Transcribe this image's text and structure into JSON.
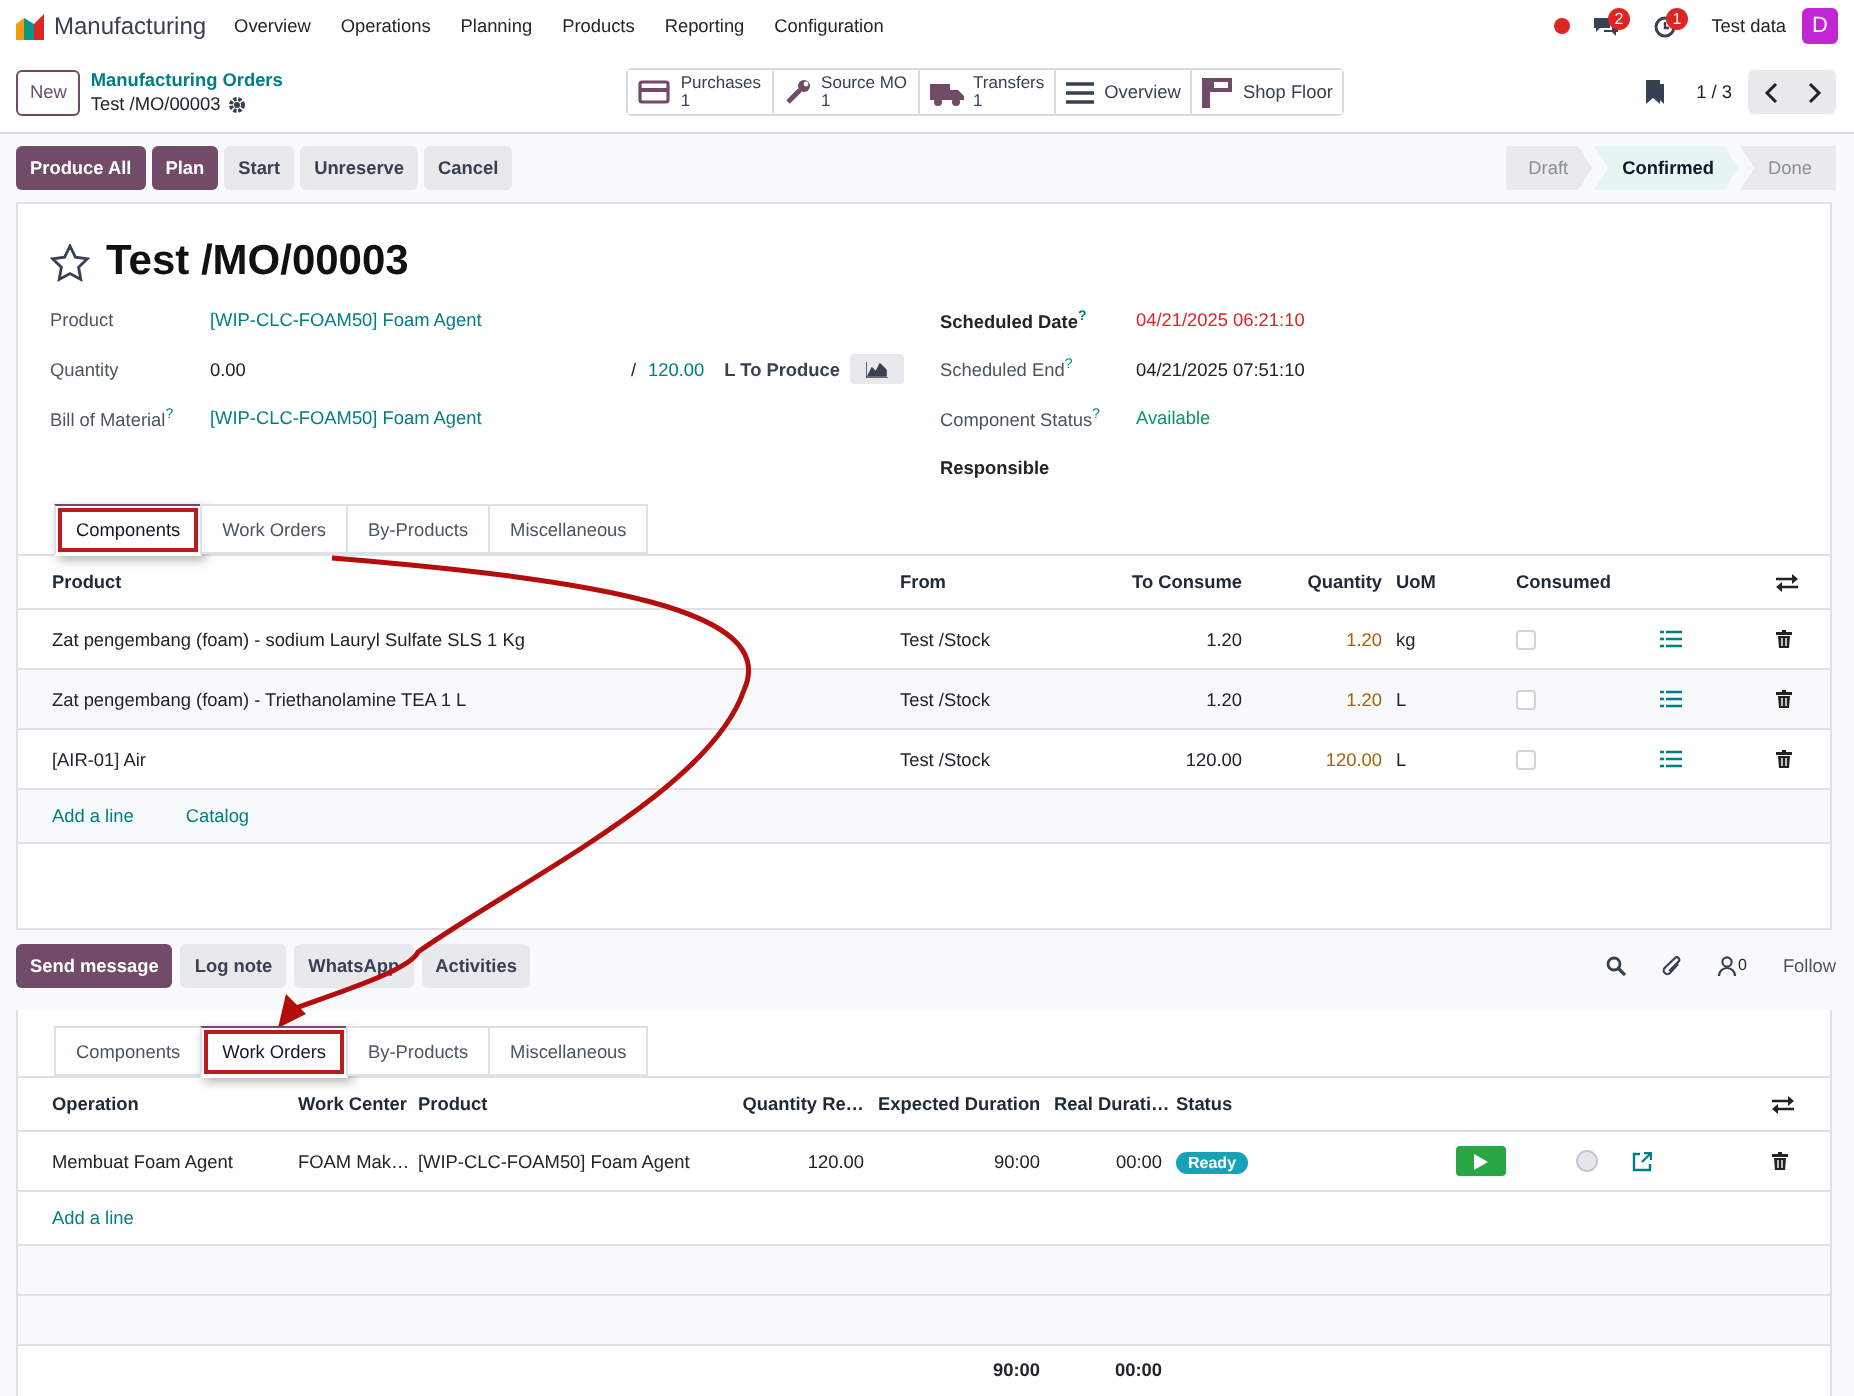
{
  "navbar": {
    "app_name": "Manufacturing",
    "menu": [
      "Overview",
      "Operations",
      "Planning",
      "Products",
      "Reporting",
      "Configuration"
    ],
    "messages_count": "2",
    "activities_count": "1",
    "user": "Test data",
    "avatar_letter": "D"
  },
  "control_panel": {
    "new_button": "New",
    "breadcrumb_parent": "Manufacturing Orders",
    "record": "Test /MO/00003",
    "smart_buttons": [
      {
        "label": "Purchases",
        "count": "1"
      },
      {
        "label": "Source MO",
        "count": "1"
      },
      {
        "label": "Transfers",
        "count": "1"
      },
      {
        "label": "Overview"
      },
      {
        "label": "Shop Floor"
      }
    ],
    "pager": "1 / 3"
  },
  "actions": [
    {
      "label": "Produce All",
      "kind": "primary"
    },
    {
      "label": "Plan",
      "kind": "primary"
    },
    {
      "label": "Start",
      "kind": "secondary"
    },
    {
      "label": "Unreserve",
      "kind": "secondary"
    },
    {
      "label": "Cancel",
      "kind": "secondary"
    }
  ],
  "status_steps": [
    {
      "label": "Draft",
      "selected": false
    },
    {
      "label": "Confirmed",
      "selected": true
    },
    {
      "label": "Done",
      "selected": false
    }
  ],
  "form": {
    "title": "Test /MO/00003",
    "starred": false,
    "product": {
      "label": "Product",
      "value": "[WIP-CLC-FOAM50] Foam Agent"
    },
    "quantity": {
      "label": "Quantity",
      "value": "0.00",
      "separator": "/",
      "target": "120.00",
      "unit_text": "L To Produce"
    },
    "bom": {
      "label": "Bill of Material$^{?}$",
      "value": "[WIP-CLC-FOAM50] Foam Agent"
    },
    "right_fields": [
      {
        "label": "Scheduled Date$^{?}$",
        "value": "04/21/2025 06:21:10",
        "kind": "late",
        "required": true
      },
      {
        "label": "Scheduled End$^{?}$",
        "value": "04/21/2025 07:51:10",
        "kind": "plain",
        "required": false
      },
      {
        "label": "Component Status$^{?}$",
        "value": "Available",
        "kind": "ok",
        "required": false
      },
      {
        "label": "Responsible",
        "required": true
      }
    ]
  },
  "tabs": [
    {
      "label": "Components",
      "selected": true,
      "highlighted": true
    },
    {
      "label": "Work Orders",
      "selected": false,
      "highlighted": false
    },
    {
      "label": "By-Products",
      "selected": false,
      "highlighted": false
    },
    {
      "label": "Miscellaneous",
      "selected": false,
      "highlighted": false
    }
  ],
  "components": {
    "columns": [
      "Product",
      "From",
      "To Consume",
      "Quantity",
      "UoM",
      "Consumed"
    ],
    "rows": [
      {
        "product": "Zat pengembang (foam) - sodium Lauryl Sulfate SLS 1 Kg",
        "from": "Test /Stock",
        "to_consume": "1.20",
        "quantity": "1.20",
        "uom": "kg",
        "consumed": false
      },
      {
        "product": "Zat pengembang (foam) - Triethanolamine TEA 1 L",
        "from": "Test /Stock",
        "to_consume": "1.20",
        "quantity": "1.20",
        "uom": "L",
        "consumed": false
      },
      {
        "product": "[AIR-01] Air",
        "from": "Test /Stock",
        "to_consume": "120.00",
        "quantity": "120.00",
        "uom": "L",
        "consumed": false
      }
    ],
    "links": [
      "Add a line",
      "Catalog"
    ]
  },
  "chatter": {
    "buttons": [
      {
        "label": "Send message",
        "kind": "primary"
      },
      {
        "label": "Log note",
        "kind": "secondary"
      },
      {
        "label": "WhatsApp",
        "kind": "secondary"
      },
      {
        "label": "Activities",
        "kind": "secondary"
      }
    ],
    "followers_count": "0",
    "follow": "Follow"
  },
  "lower_tabs": [
    {
      "label": "Components",
      "selected": false,
      "highlighted": false
    },
    {
      "label": "Work Orders",
      "selected": true,
      "highlighted": true
    },
    {
      "label": "By-Products",
      "selected": false,
      "highlighted": false
    },
    {
      "label": "Miscellaneous",
      "selected": false,
      "highlighted": false
    }
  ],
  "work_orders": {
    "columns": [
      "Operation",
      "Work Center",
      "Product",
      "Quantity Re…",
      "Expected Duration",
      "Real Durati…",
      "Status"
    ],
    "rows": [
      {
        "operation": "Membuat Foam Agent",
        "work_center": "FOAM Mak…",
        "product": "[WIP-CLC-FOAM50] Foam Agent",
        "quantity": "120.00",
        "expected": "90:00",
        "real": "00:00",
        "status": "Ready"
      }
    ],
    "add_line": "Add a line",
    "totals": {
      "expected": "90:00",
      "real": "00:00"
    }
  }
}
